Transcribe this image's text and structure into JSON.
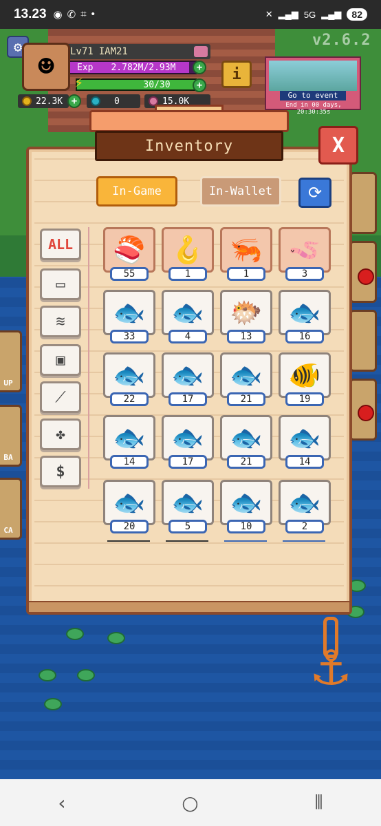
{
  "status_bar": {
    "time": "13.23",
    "battery": "82",
    "network": "5G"
  },
  "hud": {
    "level": "Lv71",
    "username": "IAM21",
    "exp_label": "Exp",
    "exp_value": "2.782M/2.93M",
    "exp_fraction": 0.95,
    "energy_value": "30/30",
    "energy_fraction": 1.0,
    "coins": "22.3K",
    "gems": "0",
    "third_currency": "15.0K"
  },
  "event": {
    "button_label": "Go to event",
    "end_text": "End in 00 days, 20:30:35s"
  },
  "version": "v2.6.2",
  "side_labels": [
    "UP",
    "BA",
    "CA"
  ],
  "inventory": {
    "title": "Inventory",
    "tab_ingame": "In-Game",
    "tab_inwallet": "In-Wallet",
    "categories": [
      {
        "label": "ALL",
        "icon": "all-text"
      },
      {
        "label": "",
        "icon": "chest-icon"
      },
      {
        "label": "",
        "icon": "fish-icon"
      },
      {
        "label": "",
        "icon": "cooler-icon"
      },
      {
        "label": "",
        "icon": "fishing-rod-icon"
      },
      {
        "label": "",
        "icon": "paw-icon"
      },
      {
        "label": "",
        "icon": "dollar-icon"
      }
    ],
    "items": [
      {
        "icon": "sushi-icon",
        "count": "55",
        "style": "pink"
      },
      {
        "icon": "hook-bait-icon",
        "count": "1",
        "style": "pink"
      },
      {
        "icon": "shrimp-bait-icon",
        "count": "1",
        "style": "pink"
      },
      {
        "icon": "worm-bait-icon",
        "count": "3",
        "style": "pink"
      },
      {
        "icon": "sardine-icon",
        "count": "33",
        "style": "plain"
      },
      {
        "icon": "green-fish-icon",
        "count": "4",
        "style": "plain"
      },
      {
        "icon": "pufferfish-icon",
        "count": "13",
        "style": "plain"
      },
      {
        "icon": "blue-fish-icon",
        "count": "16",
        "style": "plain"
      },
      {
        "icon": "perch-icon",
        "count": "22",
        "style": "plain"
      },
      {
        "icon": "striped-bass-icon",
        "count": "17",
        "style": "plain"
      },
      {
        "icon": "carp-icon",
        "count": "21",
        "style": "plain"
      },
      {
        "icon": "pink-fish-icon",
        "count": "19",
        "style": "plain"
      },
      {
        "icon": "yellow-fish-icon",
        "count": "14",
        "style": "plain"
      },
      {
        "icon": "mackerel-icon",
        "count": "17",
        "style": "plain"
      },
      {
        "icon": "golden-fish-icon",
        "count": "21",
        "style": "plain"
      },
      {
        "icon": "grey-fish-icon",
        "count": "14",
        "style": "plain"
      },
      {
        "icon": "anchovy-icon",
        "count": "20",
        "style": "plain"
      },
      {
        "icon": "needlefish-icon",
        "count": "5",
        "style": "plain"
      },
      {
        "icon": "neon-fish-icon",
        "count": "10",
        "style": "plain"
      },
      {
        "icon": "herring-icon",
        "count": "2",
        "style": "plain"
      }
    ]
  },
  "colors": {
    "accent_orange": "#f9b53a",
    "close_red": "#e25a4f",
    "refresh_blue": "#3a78d8",
    "panel": "#f4dcb9"
  }
}
